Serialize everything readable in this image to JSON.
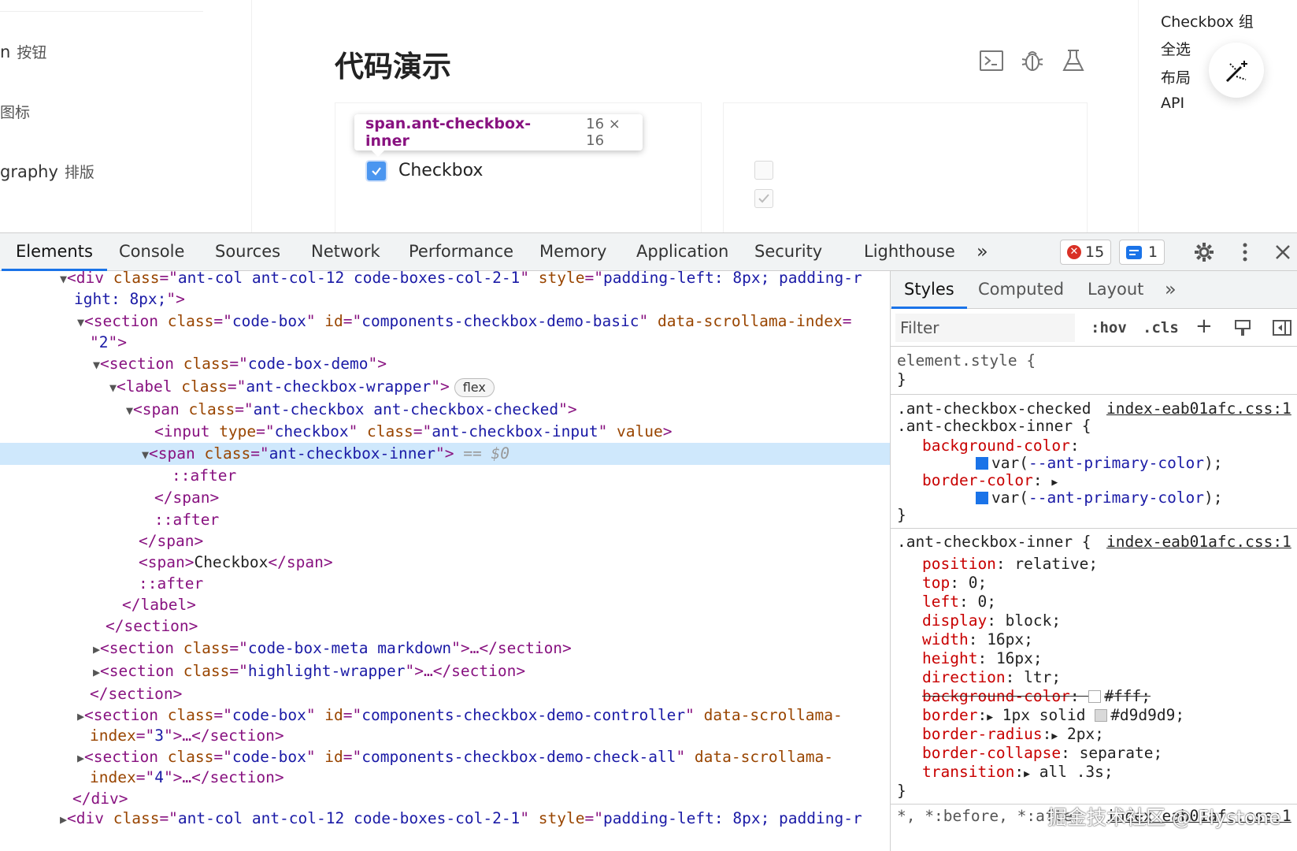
{
  "site": {
    "menu": [
      {
        "en": "n",
        "zh": "按钮"
      },
      {
        "en": "",
        "zh": "图标"
      },
      {
        "en": "graphy",
        "zh": "排版"
      }
    ],
    "page_title": "代码演示",
    "tooltip": {
      "selector": "span.ant-checkbox-inner",
      "size": "16 × 16"
    },
    "checkbox_label": "Checkbox",
    "toc": [
      "Checkbox 组",
      "全选",
      "布局",
      "API"
    ],
    "toolbar_icons": [
      "terminal-icon",
      "bug-icon",
      "flask-icon"
    ]
  },
  "devtools": {
    "tabs": [
      "Elements",
      "Console",
      "Sources",
      "Network",
      "Performance",
      "Memory",
      "Application",
      "Security",
      "Lighthouse"
    ],
    "more": "»",
    "errors": "15",
    "messages": "1",
    "styles_tabs": [
      "Styles",
      "Computed",
      "Layout"
    ],
    "styles_more": "»",
    "filter_placeholder": "Filter",
    "hov": ":hov",
    "cls": ".cls",
    "flex_badge": "flex",
    "selected_marker": "== $0"
  },
  "colors": {
    "accent": "#1a73e8",
    "checkbox_primary": "#4b96f0",
    "tag": "#881280",
    "attr_name": "#994500",
    "attr_value": "#1a1aa6",
    "css_property": "#c80000",
    "selected_row": "#cfe8fc"
  },
  "styles_rules": {
    "element_style": "element.style {",
    "rule1_selector_a": ".ant-checkbox-checked",
    "rule1_selector_b": ".ant-checkbox-inner {",
    "rule1_source": "index-eab01afc.css:1",
    "rule2_selector": ".ant-checkbox-inner {",
    "rule2_source": "index-eab01afc.css:1",
    "rule3_selector": "*, *:before, *:after",
    "rule3_source": "index-eab01afc.css:1"
  },
  "watermark": "掘金技术社区 @ Flystone"
}
